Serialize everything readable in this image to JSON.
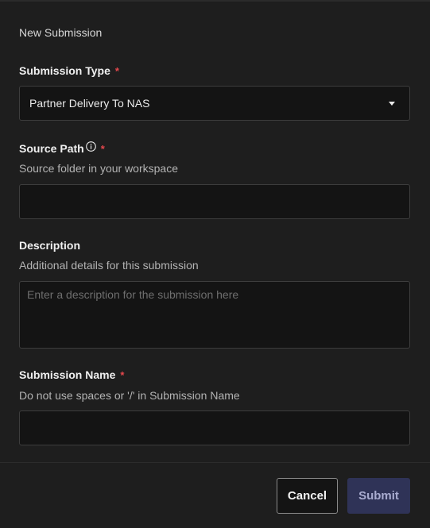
{
  "dialog": {
    "title": "New Submission"
  },
  "fields": {
    "submission_type": {
      "label": "Submission Type",
      "required_marker": "*",
      "value": "Partner Delivery To NAS"
    },
    "source_path": {
      "label": "Source Path",
      "required_marker": "*",
      "helper": "Source folder in your workspace",
      "value": ""
    },
    "description": {
      "label": "Description",
      "helper": "Additional details for this submission",
      "placeholder": "Enter a description for the submission here",
      "value": ""
    },
    "submission_name": {
      "label": "Submission Name",
      "required_marker": "*",
      "helper": "Do not use spaces or '/' in Submission Name",
      "value": ""
    }
  },
  "actions": {
    "cancel_label": "Cancel",
    "submit_label": "Submit"
  },
  "colors": {
    "background": "#1e1e1e",
    "required": "#e5484d",
    "submit_bg": "#2f3357",
    "submit_text": "#a9acd0"
  },
  "icons": {
    "info": "info-circle-icon",
    "dropdown": "chevron-down-icon"
  }
}
